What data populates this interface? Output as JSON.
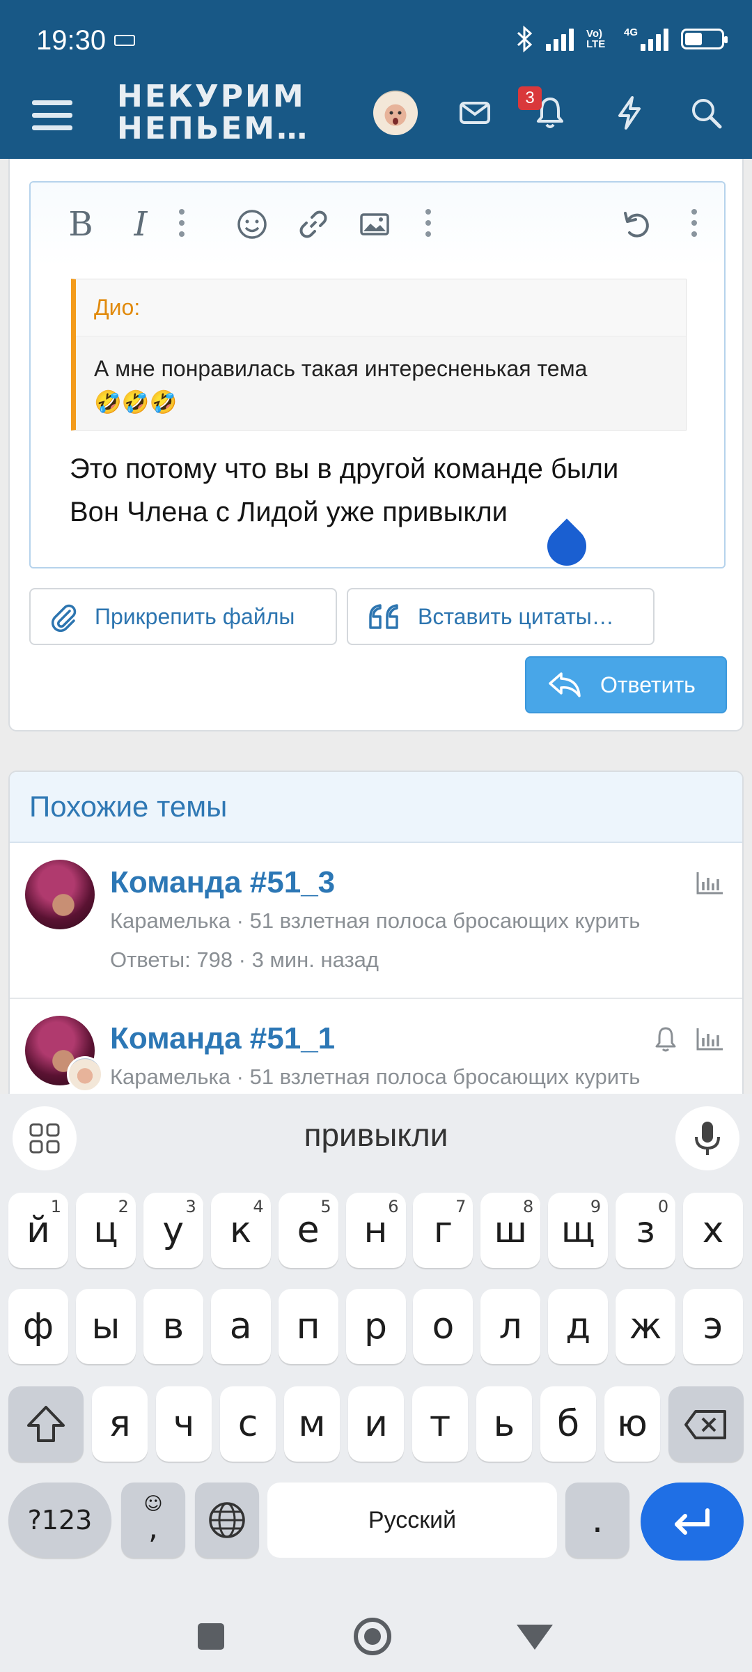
{
  "status_bar": {
    "time": "19:30",
    "volte": "Vo) LTE",
    "network": "4G"
  },
  "header": {
    "logo_line1": "НЕКУРИМ",
    "logo_line2": "НЕПЬЕМ…",
    "notification_count": "3"
  },
  "editor": {
    "quote_author": "Дио:",
    "quote_text": "А мне понравилась такая интересненькая тема",
    "quote_emoji": "🤣🤣🤣",
    "message_line1": "Это потому что вы в другой команде были",
    "message_line2": "Вон Члена с Лидой уже привыкли"
  },
  "buttons": {
    "attach": "Прикрепить файлы",
    "insert_quotes": "Вставить цитаты…",
    "reply": "Ответить"
  },
  "similar": {
    "title": "Похожие темы",
    "threads": [
      {
        "title": "Команда #51_3",
        "meta": "Карамелька · 51 взлетная полоса бросающих курить",
        "stats": "Ответы: 798 · 3 мин. назад"
      },
      {
        "title": "Команда #51_1",
        "meta": "Карамелька · 51 взлетная полоса бросающих курить"
      }
    ]
  },
  "keyboard": {
    "suggestion": "привыкли",
    "row1": [
      {
        "k": "й",
        "n": "1"
      },
      {
        "k": "ц",
        "n": "2"
      },
      {
        "k": "у",
        "n": "3"
      },
      {
        "k": "к",
        "n": "4"
      },
      {
        "k": "е",
        "n": "5"
      },
      {
        "k": "н",
        "n": "6"
      },
      {
        "k": "г",
        "n": "7"
      },
      {
        "k": "ш",
        "n": "8"
      },
      {
        "k": "щ",
        "n": "9"
      },
      {
        "k": "з",
        "n": "0"
      },
      {
        "k": "х",
        "n": ""
      }
    ],
    "row2": [
      "ф",
      "ы",
      "в",
      "а",
      "п",
      "р",
      "о",
      "л",
      "д",
      "ж",
      "э"
    ],
    "row3": [
      "я",
      "ч",
      "с",
      "м",
      "и",
      "т",
      "ь",
      "б",
      "ю"
    ],
    "symbols": "?123",
    "comma": ",",
    "space": "Русский",
    "period": "."
  },
  "colors": {
    "header": "#185886",
    "accent": "#2c77b5",
    "quote_border": "#f39b1b",
    "reply_button": "#48a6e8",
    "enter_key": "#1f6fe5"
  }
}
